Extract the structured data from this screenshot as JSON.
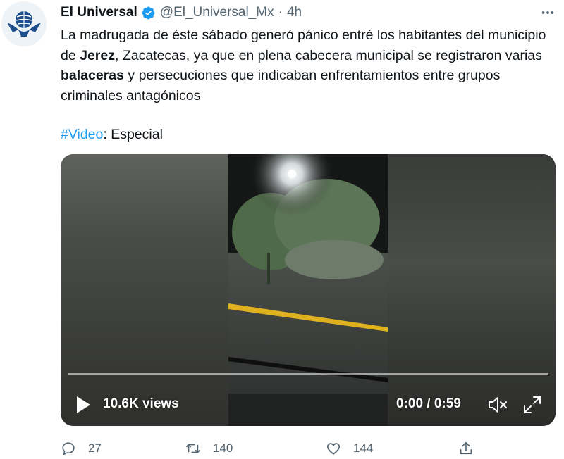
{
  "tweet": {
    "display_name": "El Universal",
    "handle": "@El_Universal_Mx",
    "separator": "·",
    "time": "4h",
    "text_a": "La madrugada de éste sábado generó pánico entré los habitantes del municipio de ",
    "text_bold_1": "Jerez",
    "text_b": ", Zacatecas,  ya que en plena cabecera municipal se registraron varias ",
    "text_bold_2": "balaceras",
    "text_c": " y persecuciones que indicaban enfrentamientos entre grupos criminales antagónicos",
    "hashtag": "#Video",
    "credit": ": Especial"
  },
  "video": {
    "views": "10.6K views",
    "time": "0:00 / 0:59",
    "progress_fraction": 0
  },
  "actions": {
    "replies": "27",
    "retweets": "140",
    "likes": "144"
  },
  "colors": {
    "accent": "#1d9bf0",
    "muted": "#536471",
    "text": "#0f1419"
  },
  "icons": {
    "avatar": "el-universal-logo",
    "verified": "verified-badge-icon",
    "more": "more-icon",
    "play": "play-icon",
    "mute": "mute-icon",
    "fullscreen": "fullscreen-icon",
    "reply": "reply-icon",
    "retweet": "retweet-icon",
    "like": "like-icon",
    "share": "share-icon"
  }
}
